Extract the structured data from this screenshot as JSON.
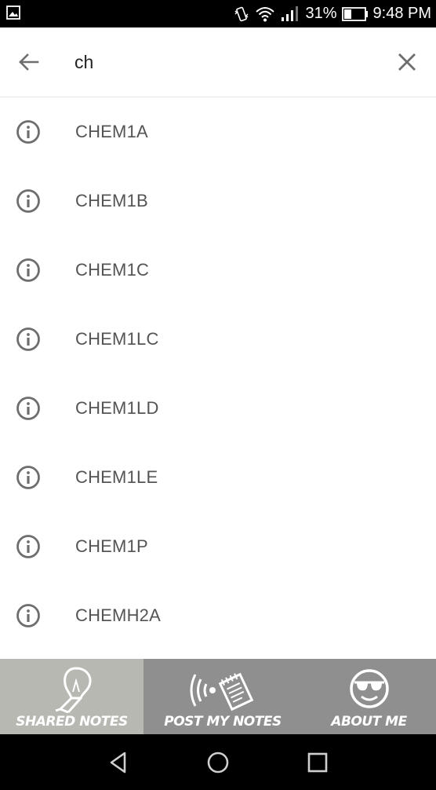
{
  "status_bar": {
    "battery_percent": "31%",
    "time": "9:48 PM",
    "icons": [
      "image-icon",
      "vibrate-icon",
      "wifi-icon",
      "signal-icon",
      "battery-icon"
    ]
  },
  "search": {
    "query": "ch",
    "icons": {
      "back": "arrow-left-icon",
      "clear": "close-icon"
    }
  },
  "results": [
    {
      "label": "CHEM1A",
      "icon": "info-icon"
    },
    {
      "label": "CHEM1B",
      "icon": "info-icon"
    },
    {
      "label": "CHEM1C",
      "icon": "info-icon"
    },
    {
      "label": "CHEM1LC",
      "icon": "info-icon"
    },
    {
      "label": "CHEM1LD",
      "icon": "info-icon"
    },
    {
      "label": "CHEM1LE",
      "icon": "info-icon"
    },
    {
      "label": "CHEM1P",
      "icon": "info-icon"
    },
    {
      "label": "CHEMH2A",
      "icon": "info-icon"
    }
  ],
  "app_nav": {
    "tabs": [
      {
        "label": "SHARED NOTES",
        "icon": "lightbulb-icon",
        "active": true
      },
      {
        "label": "POST MY NOTES",
        "icon": "broadcast-notes-icon",
        "active": false
      },
      {
        "label": "ABOUT ME",
        "icon": "sunglasses-face-icon",
        "active": false
      }
    ]
  },
  "system_nav": {
    "buttons": [
      "back-triangle-icon",
      "home-circle-icon",
      "recents-square-icon"
    ]
  },
  "colors": {
    "status_bar": "#000000",
    "result_text": "#545454",
    "icon_gray": "#6e6e6e",
    "tab_active": "#b8b8b3",
    "tab_inactive": "#8f8f8f"
  }
}
